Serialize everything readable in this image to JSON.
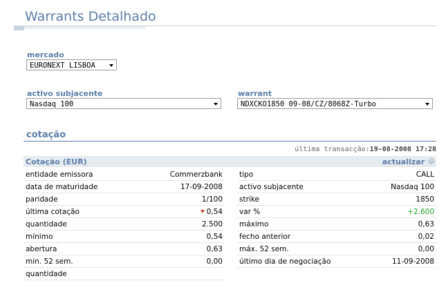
{
  "page": {
    "title": "Warrants Detalhado"
  },
  "filters": {
    "mercado": {
      "label": "mercado",
      "value": "EURONEXT LISBOA"
    },
    "activo": {
      "label": "activo subjacente",
      "value": "Nasdaq 100"
    },
    "warrant": {
      "label": "warrant",
      "value": "NDXCKO1850 09-08/CZ/8068Z-Turbo"
    }
  },
  "section": {
    "title": "cotação",
    "last_trade_label": "última transacção:",
    "last_trade_value": "19-08-2008 17:28",
    "header_left": "Cotação (EUR)",
    "header_right": "actualizar"
  },
  "left_rows": [
    {
      "label": "entidade emissora",
      "value": "Commerzbank"
    },
    {
      "label": "data de maturidade",
      "value": "17-09-2008"
    },
    {
      "label": "paridade",
      "value": "1/100"
    },
    {
      "label": "última cotação",
      "value": "0,54"
    },
    {
      "label": "quantidade",
      "value": "2.500"
    },
    {
      "label": "mínimo",
      "value": "0,54"
    },
    {
      "label": "abertura",
      "value": "0,63"
    },
    {
      "label": "min. 52 sem.",
      "value": "0,00"
    },
    {
      "label": "quantidade",
      "value": ""
    }
  ],
  "right_rows": [
    {
      "label": "tipo",
      "value": "CALL"
    },
    {
      "label": "activo subjacente",
      "value": "Nasdaq 100"
    },
    {
      "label": "strike",
      "value": "1850"
    },
    {
      "label": "var %",
      "value": "+2.600"
    },
    {
      "label": "máximo",
      "value": "0,63"
    },
    {
      "label": "fecho anterior",
      "value": "0,02"
    },
    {
      "label": "máx. 52 sem.",
      "value": "0,00"
    },
    {
      "label": "último dia de negociação",
      "value": "11-09-2008"
    }
  ],
  "colors": {
    "accent": "#5b7ea8",
    "positive": "#22a022",
    "negative": "#c8382b"
  },
  "icons": {
    "select_arrow": "chevron-down-icon",
    "refresh": "refresh-icon",
    "price_down": "triangle-down-icon"
  }
}
